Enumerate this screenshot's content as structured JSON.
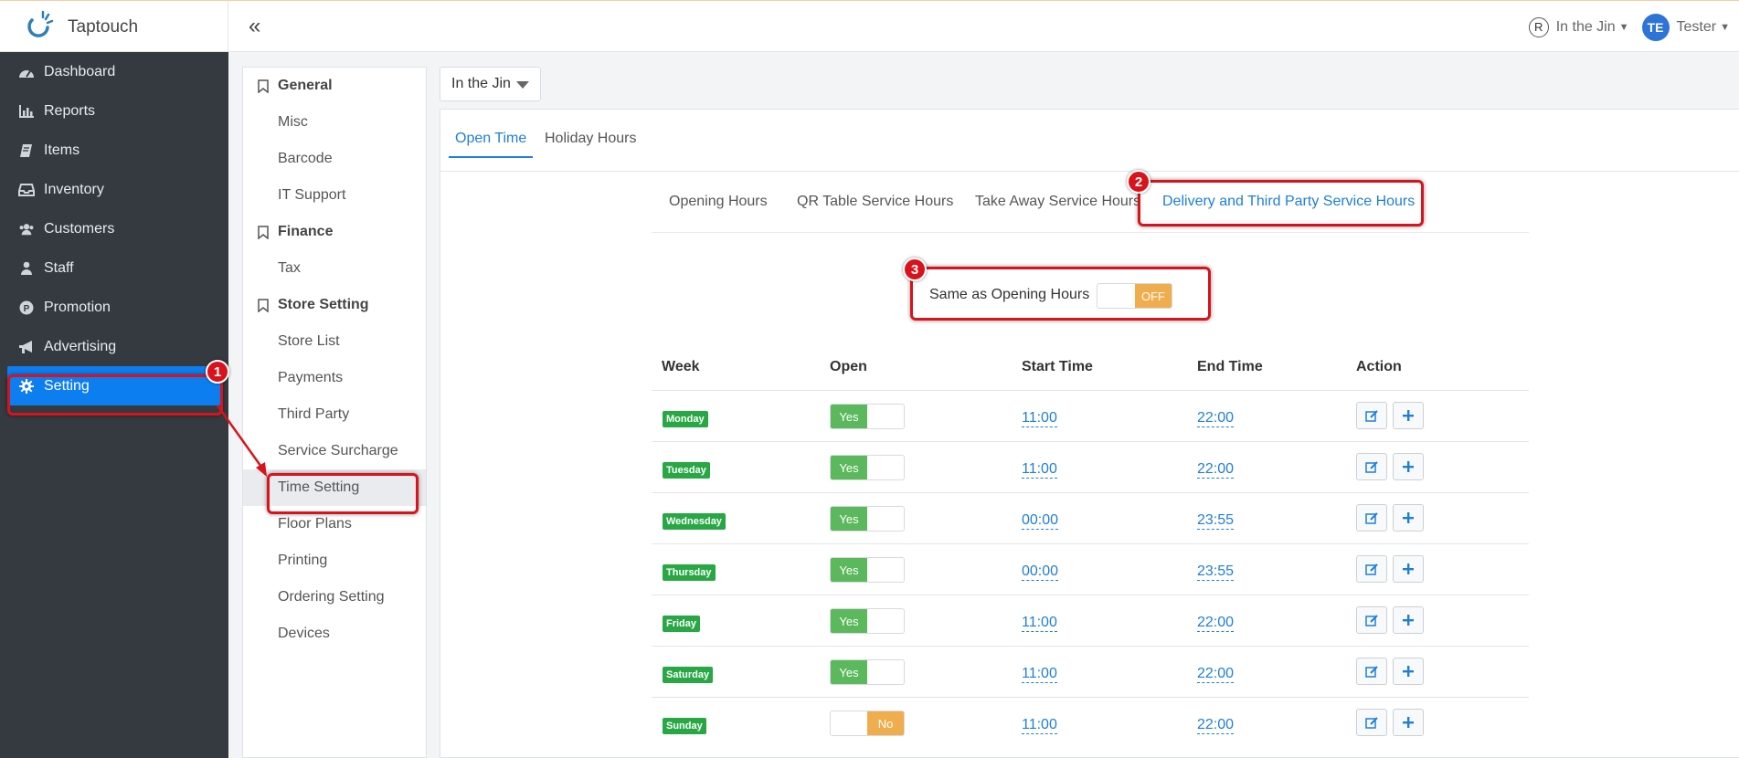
{
  "app": {
    "name": "Taptouch",
    "logo_icon": "taptouch-logo-icon"
  },
  "topbar": {
    "collapse_symbol": "«",
    "store": "In the Jin",
    "store_icon": "registered-circle-icon",
    "user_initials": "TE",
    "user_name": "Tester"
  },
  "sidebar": {
    "items": [
      {
        "label": "Dashboard",
        "icon": "dashboard-icon"
      },
      {
        "label": "Reports",
        "icon": "bar-chart-icon"
      },
      {
        "label": "Items",
        "icon": "book-icon"
      },
      {
        "label": "Inventory",
        "icon": "inbox-icon"
      },
      {
        "label": "Customers",
        "icon": "users-icon"
      },
      {
        "label": "Staff",
        "icon": "staff-icon"
      },
      {
        "label": "Promotion",
        "icon": "promotion-p-icon"
      },
      {
        "label": "Advertising",
        "icon": "megaphone-icon"
      },
      {
        "label": "Setting",
        "icon": "gear-icon",
        "active": true
      }
    ]
  },
  "settings_menu": {
    "general": {
      "label": "General",
      "items": [
        "Misc",
        "Barcode",
        "IT Support"
      ]
    },
    "finance": {
      "label": "Finance",
      "items": [
        "Tax"
      ]
    },
    "store_setting": {
      "label": "Store Setting",
      "items": [
        "Store List",
        "Payments",
        "Third Party",
        "Service Surcharge",
        "Time Setting",
        "Floor Plans",
        "Printing",
        "Ordering Setting",
        "Devices"
      ]
    }
  },
  "store_select": {
    "value": "In the Jin"
  },
  "tabs": {
    "open_time": "Open Time",
    "holiday_hours": "Holiday Hours"
  },
  "subtabs": {
    "opening": "Opening Hours",
    "qr": "QR Table Service Hours",
    "takeaway": "Take Away Service Hours",
    "delivery": "Delivery and Third Party Service Hours"
  },
  "same_as": {
    "label": "Same as Opening Hours",
    "state": "OFF"
  },
  "table": {
    "headers": {
      "week": "Week",
      "open": "Open",
      "start": "Start Time",
      "end": "End Time",
      "action": "Action"
    },
    "rows": [
      {
        "day": "Monday",
        "open": "Yes",
        "start": "11:00",
        "end": "22:00"
      },
      {
        "day": "Tuesday",
        "open": "Yes",
        "start": "11:00",
        "end": "22:00"
      },
      {
        "day": "Wednesday",
        "open": "Yes",
        "start": "00:00",
        "end": "23:55"
      },
      {
        "day": "Thursday",
        "open": "Yes",
        "start": "00:00",
        "end": "23:55"
      },
      {
        "day": "Friday",
        "open": "Yes",
        "start": "11:00",
        "end": "22:00"
      },
      {
        "day": "Saturday",
        "open": "Yes",
        "start": "11:00",
        "end": "22:00"
      },
      {
        "day": "Sunday",
        "open": "No",
        "start": "11:00",
        "end": "22:00"
      }
    ]
  },
  "annotations": {
    "m1": "1",
    "m2": "2",
    "m3": "3"
  },
  "colors": {
    "primary": "#1e7fd8",
    "sidebar_bg": "#343a40",
    "active_nav": "#0d7ef0",
    "highlight": "#d9121b",
    "yes_green": "#5cb85c",
    "no_orange": "#f0ad4e",
    "badge_green": "#28a745"
  }
}
